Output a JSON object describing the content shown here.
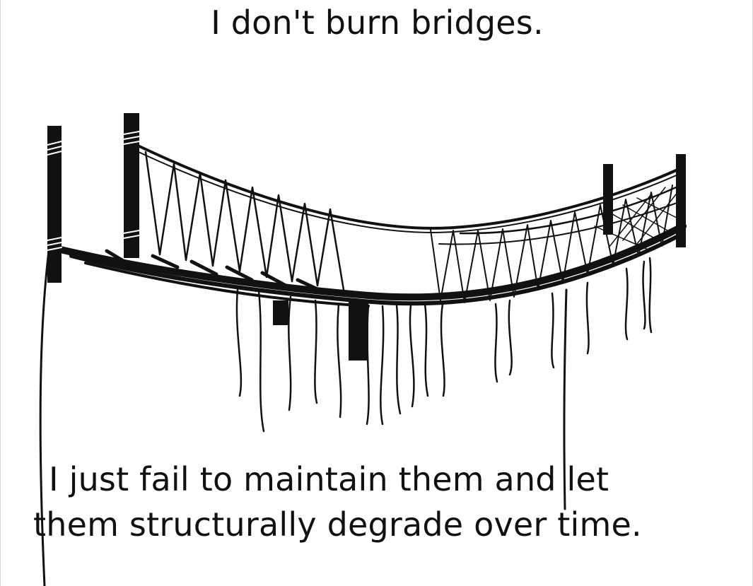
{
  "meme": {
    "top_caption": "I don't burn bridges.",
    "bottom_caption_line1": "I just fail to maintain them and let",
    "bottom_caption_line2": "them structurally degrade over time.",
    "illustration": "rope-bridge-sketch-icon"
  },
  "colors": {
    "background": "#ffffff",
    "ink": "#111111"
  }
}
